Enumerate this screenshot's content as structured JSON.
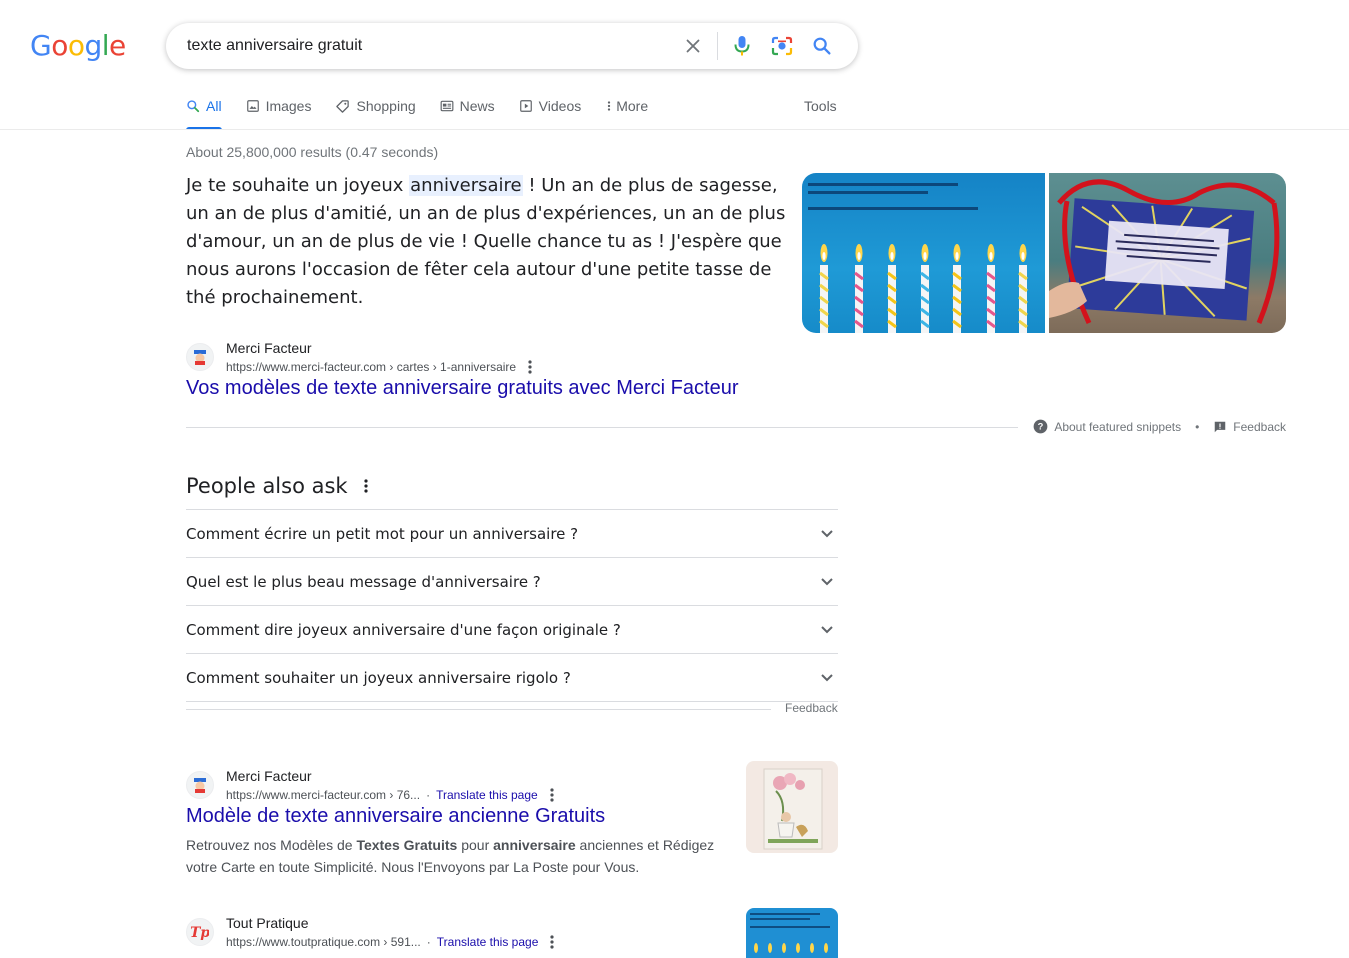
{
  "header": {
    "logo_letters": [
      "G",
      "o",
      "o",
      "g",
      "l",
      "e"
    ],
    "logo_colors": [
      "#4285f4",
      "#ea4335",
      "#fbbc05",
      "#4285f4",
      "#34a853",
      "#ea4335"
    ],
    "search_query": "texte anniversaire gratuit"
  },
  "tabs": [
    {
      "label": "All",
      "icon": "search-icon",
      "active": true
    },
    {
      "label": "Images",
      "icon": "image-icon"
    },
    {
      "label": "Shopping",
      "icon": "tag-icon"
    },
    {
      "label": "News",
      "icon": "news-icon"
    },
    {
      "label": "Videos",
      "icon": "play-icon"
    },
    {
      "label": "More",
      "icon": "more-vert-icon"
    }
  ],
  "tools_label": "Tools",
  "result_stats": "About 25,800,000 results (0.47 seconds)",
  "featured_snippet": {
    "text_before": "Je te souhaite un joyeux ",
    "highlight": "anniversaire",
    "text_after": " ! Un an de plus de sagesse, un an de plus d'amitié, un an de plus d'expériences, un an de plus d'amour, un an de plus de vie ! Quelle chance tu as ! J'espère que nous aurons l'occasion de fêter cela autour d'une petite tasse de thé prochainement.",
    "source_name": "Merci Facteur",
    "source_url": "https://www.merci-facteur.com › cartes › 1-anniversaire",
    "title": "Vos modèles de texte anniversaire gratuits avec Merci Facteur",
    "about_label": "About featured snippets",
    "separator": "•",
    "feedback_label": "Feedback"
  },
  "people_also_ask": {
    "title": "People also ask",
    "questions": [
      "Comment écrire un petit mot pour un anniversaire ?",
      "Quel est le plus beau message d'anniversaire ?",
      "Comment dire joyeux anniversaire d'une façon originale ?",
      "Comment souhaiter un joyeux anniversaire rigolo ?"
    ],
    "feedback_label": "Feedback"
  },
  "results": [
    {
      "source_name": "Merci Facteur",
      "source_url": "https://www.merci-facteur.com › 76...",
      "translate_label": "Translate this page",
      "title": "Modèle de texte anniversaire ancienne Gratuits",
      "desc_1": "Retrouvez nos Modèles de ",
      "desc_b1": "Textes Gratuits",
      "desc_2": " pour ",
      "desc_b2": "anniversaire",
      "desc_3": " anciennes et Rédigez votre Carte en toute Simplicité. Nous l'Envoyons par La Poste pour Vous."
    },
    {
      "source_name": "Tout Pratique",
      "source_url": "https://www.toutpratique.com › 591...",
      "translate_label": "Translate this page"
    }
  ],
  "colors": {
    "link": "#1a0dab",
    "accent": "#1a73e8",
    "secondary_text": "#70757a"
  }
}
